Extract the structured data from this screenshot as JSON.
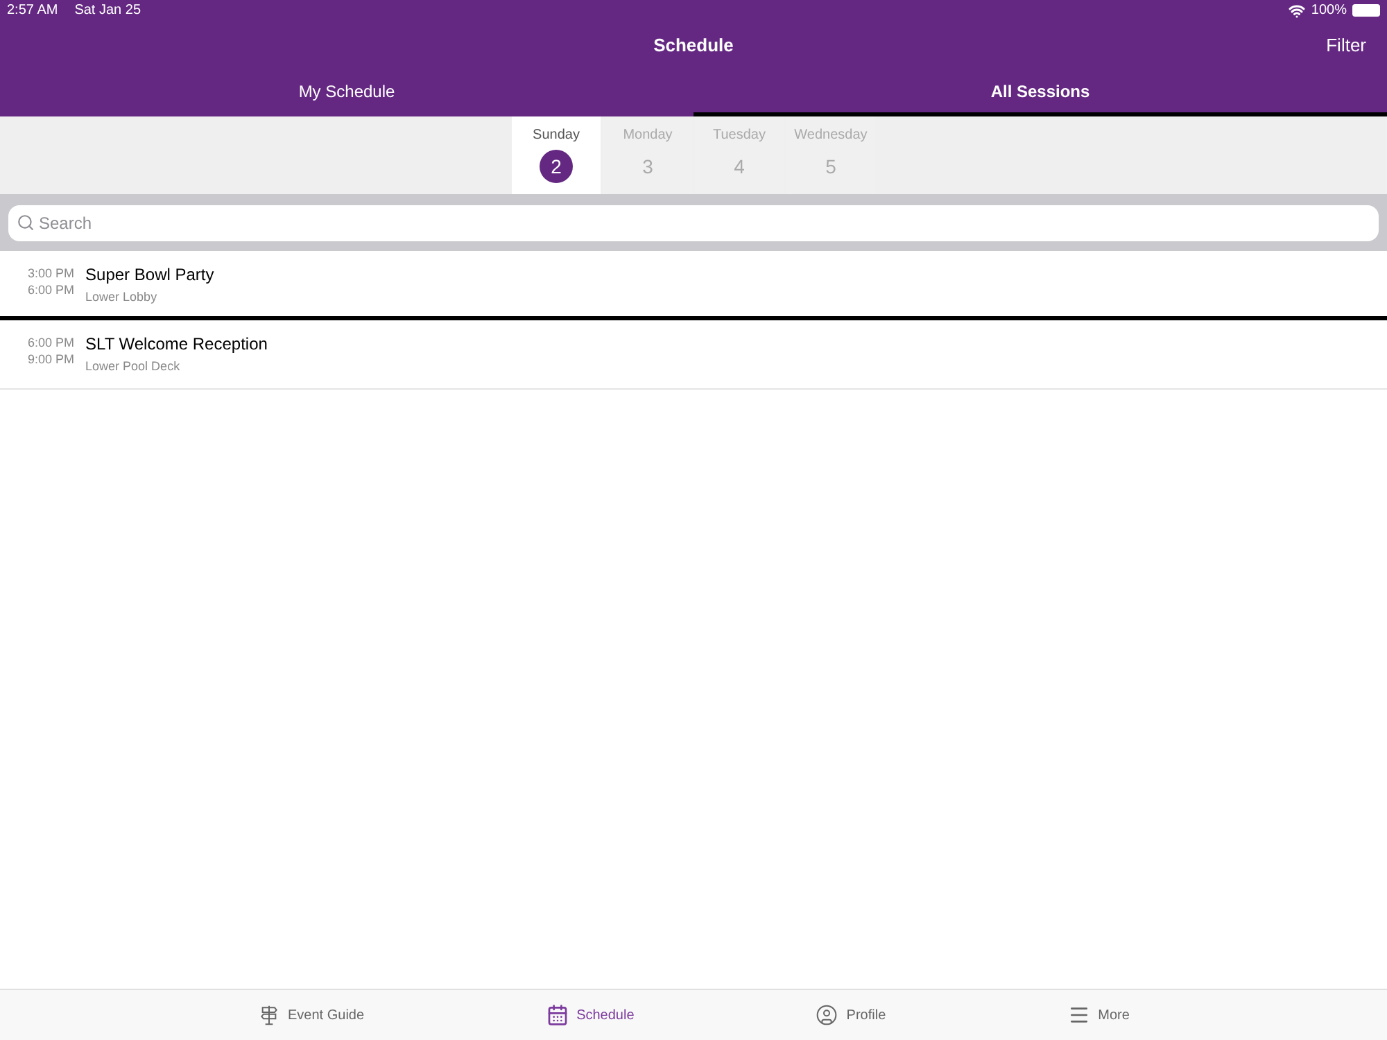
{
  "status_bar": {
    "time": "2:57 AM",
    "date": "Sat Jan 25",
    "battery": "100%"
  },
  "nav": {
    "title": "Schedule",
    "action": "Filter"
  },
  "tabs": [
    {
      "label": "My Schedule",
      "selected": false
    },
    {
      "label": "All Sessions",
      "selected": true
    }
  ],
  "days": [
    {
      "weekday": "Sunday",
      "day": "2",
      "selected": true
    },
    {
      "weekday": "Monday",
      "day": "3",
      "selected": false
    },
    {
      "weekday": "Tuesday",
      "day": "4",
      "selected": false
    },
    {
      "weekday": "Wednesday",
      "day": "5",
      "selected": false
    }
  ],
  "search": {
    "placeholder": "Search"
  },
  "sessions": [
    {
      "start": "3:00 PM",
      "end": "6:00 PM",
      "title": "Super Bowl Party",
      "location": "Lower Lobby"
    },
    {
      "start": "6:00 PM",
      "end": "9:00 PM",
      "title": "SLT Welcome Reception",
      "location": "Lower Pool Deck"
    }
  ],
  "tab_bar": [
    {
      "kind": "guide",
      "label": "Event Guide",
      "selected": false
    },
    {
      "kind": "calendar",
      "label": "Schedule",
      "selected": true
    },
    {
      "kind": "profile",
      "label": "Profile",
      "selected": false
    },
    {
      "kind": "menu",
      "label": "More",
      "selected": false
    }
  ]
}
